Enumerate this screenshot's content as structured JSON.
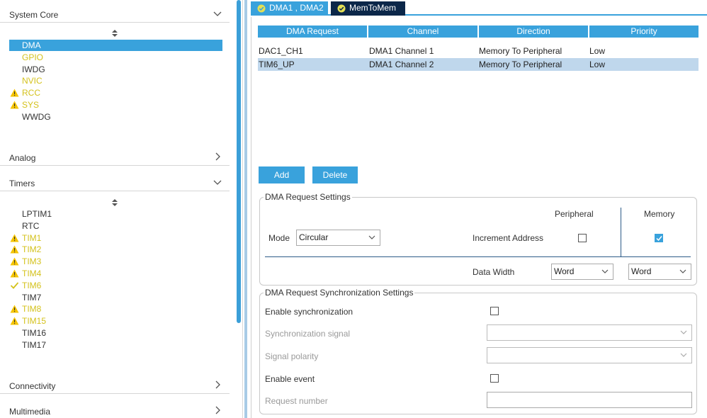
{
  "sidebar": {
    "system_core": {
      "label": "System Core",
      "items": [
        {
          "label": "DMA",
          "state": "selected"
        },
        {
          "label": "GPIO",
          "state": "warn-text"
        },
        {
          "label": "IWDG",
          "state": "normal"
        },
        {
          "label": "NVIC",
          "state": "warn-text"
        },
        {
          "label": "RCC",
          "state": "warning"
        },
        {
          "label": "SYS",
          "state": "warning"
        },
        {
          "label": "WWDG",
          "state": "normal"
        }
      ]
    },
    "analog": {
      "label": "Analog"
    },
    "timers": {
      "label": "Timers",
      "items": [
        {
          "label": "LPTIM1",
          "state": "normal"
        },
        {
          "label": "RTC",
          "state": "normal"
        },
        {
          "label": "TIM1",
          "state": "warning"
        },
        {
          "label": "TIM2",
          "state": "warning"
        },
        {
          "label": "TIM3",
          "state": "warning"
        },
        {
          "label": "TIM4",
          "state": "warning"
        },
        {
          "label": "TIM6",
          "state": "check"
        },
        {
          "label": "TIM7",
          "state": "normal"
        },
        {
          "label": "TIM8",
          "state": "warning"
        },
        {
          "label": "TIM15",
          "state": "warning"
        },
        {
          "label": "TIM16",
          "state": "normal"
        },
        {
          "label": "TIM17",
          "state": "normal"
        }
      ]
    },
    "connectivity": {
      "label": "Connectivity"
    },
    "multimedia": {
      "label": "Multimedia"
    }
  },
  "tabs": [
    {
      "label": "DMA1 , DMA2"
    },
    {
      "label": "MemToMem"
    }
  ],
  "table": {
    "headers": [
      "DMA Request",
      "Channel",
      "Direction",
      "Priority"
    ],
    "rows": [
      [
        "DAC1_CH1",
        "DMA1 Channel 1",
        "Memory To Peripheral",
        "Low"
      ],
      [
        "TIM6_UP",
        "DMA1 Channel 2",
        "Memory To Peripheral",
        "Low"
      ]
    ]
  },
  "buttons": {
    "add": "Add",
    "delete": "Delete"
  },
  "request_settings": {
    "title": "DMA Request Settings",
    "peripheral_header": "Peripheral",
    "memory_header": "Memory",
    "mode_label": "Mode",
    "mode_value": "Circular",
    "increment_label": "Increment Address",
    "peripheral_increment": false,
    "memory_increment": true,
    "data_width_label": "Data Width",
    "peripheral_width": "Word",
    "memory_width": "Word"
  },
  "sync_settings": {
    "title": "DMA Request Synchronization Settings",
    "enable_sync_label": "Enable synchronization",
    "sync_signal_label": "Synchronization signal",
    "sync_signal_value": "",
    "signal_polarity_label": "Signal polarity",
    "signal_polarity_value": "",
    "enable_event_label": "Enable event",
    "request_number_label": "Request number",
    "request_number_value": ""
  },
  "colors": {
    "accent": "#39a2dc",
    "tab_dark": "#0b2749",
    "warning": "#f5c400",
    "warn_text": "#d4c21c",
    "selected_row": "#bfd7ec"
  }
}
